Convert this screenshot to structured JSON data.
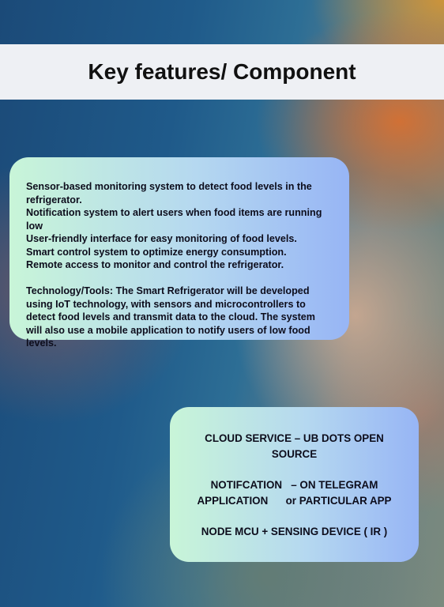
{
  "title": "Key features/ Component",
  "features_card": {
    "lines": [
      "Sensor-based monitoring system to detect food levels in the refrigerator.",
      "Notification system to alert users when food items are running low",
      "User-friendly interface for easy monitoring of food levels.",
      "Smart control system to optimize energy consumption.",
      "Remote access to monitor and control the refrigerator."
    ],
    "technology": "Technology/Tools: The Smart Refrigerator will be developed using IoT technology, with sensors and microcontrollers to detect food levels and transmit data to the cloud. The system will also use a mobile application to notify users of low food levels."
  },
  "components_card": {
    "cloud_line1": "CLOUD SERVICE – UB DOTS OPEN",
    "cloud_line2": "SOURCE",
    "notif_line1": "NOTIFCATION   – ON TELEGRAM",
    "notif_line2": "APPLICATION      or PARTICULAR APP",
    "node": "NODE MCU + SENSING DEVICE ( IR )"
  },
  "colors": {
    "title_bar_bg": "#eef0f4",
    "card_gradient_start": "#c8f5d8",
    "card_gradient_end": "#97b5f5",
    "text": "#0d0d1c"
  }
}
